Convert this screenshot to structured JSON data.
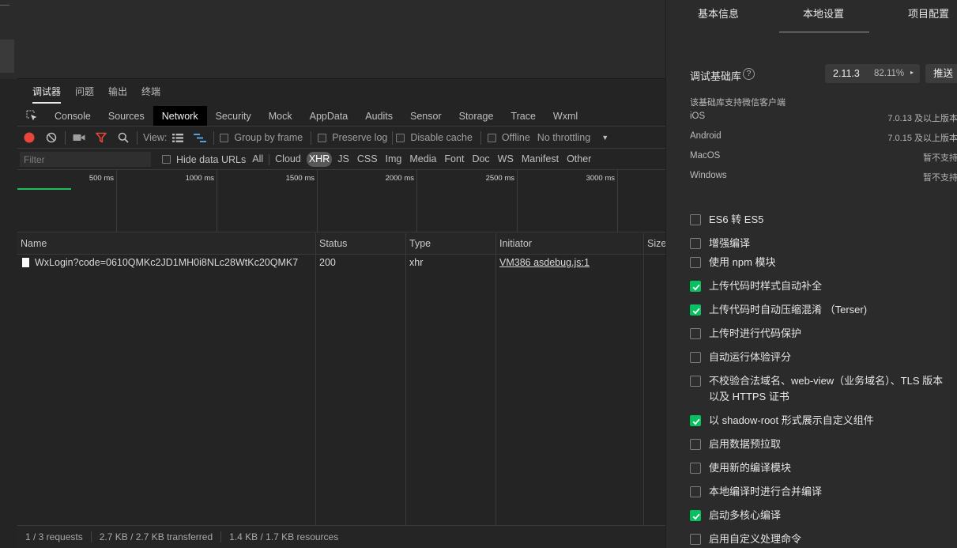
{
  "left_panel": {
    "panel_tabs": [
      "调试器",
      "问题",
      "输出",
      "终端"
    ],
    "tool_tabs": [
      "Console",
      "Sources",
      "Network",
      "Security",
      "Mock",
      "AppData",
      "Audits",
      "Sensor",
      "Storage",
      "Trace",
      "Wxml"
    ],
    "toolbar": {
      "view_label": "View:",
      "group_by_frame": "Group by frame",
      "preserve_log": "Preserve log",
      "disable_cache": "Disable cache",
      "offline": "Offline",
      "throttling": "No throttling"
    },
    "filter": {
      "placeholder": "Filter",
      "hide_data_urls": "Hide data URLs",
      "types": [
        "All",
        "Cloud",
        "XHR",
        "JS",
        "CSS",
        "Img",
        "Media",
        "Font",
        "Doc",
        "WS",
        "Manifest",
        "Other"
      ],
      "active_type": "XHR"
    },
    "overview": {
      "ticks": [
        "500 ms",
        "1000 ms",
        "1500 ms",
        "2000 ms",
        "2500 ms",
        "3000 ms"
      ],
      "bar_color": "#1fbf5a"
    },
    "table": {
      "columns": [
        "Name",
        "Status",
        "Type",
        "Initiator",
        "Size"
      ],
      "rows": [
        {
          "name": "WxLogin?code=0610QMKc2JD1MH0i8NLc28WtKc20QMK7",
          "status": "200",
          "type": "xhr",
          "initiator": "VM386 asdebug.js:1"
        }
      ]
    },
    "status_bar": [
      "1 / 3 requests",
      "2.7 KB / 2.7 KB transferred",
      "1.4 KB / 1.7 KB resources"
    ],
    "colors": {
      "record": "#e8453c",
      "filter_icon": "#e8453c",
      "view_icon": "#5a9fd6"
    }
  },
  "right_panel": {
    "tabs": [
      "基本信息",
      "本地设置",
      "项目配置"
    ],
    "active_tab": "本地设置",
    "debug_lib": {
      "label": "调试基础库",
      "version": "2.11.3",
      "percent": "82.11%",
      "push": "推送"
    },
    "support_note": "该基础库支持微信客户端",
    "os_support": [
      {
        "name": "iOS",
        "value": "7.0.13 及以上版本"
      },
      {
        "name": "Android",
        "value": "7.0.15 及以上版本"
      },
      {
        "name": "MacOS",
        "value": "暂不支持"
      },
      {
        "name": "Windows",
        "value": "暂不支持"
      }
    ],
    "settings": [
      {
        "label": "ES6 转 ES5",
        "checked": false
      },
      {
        "label": "增强编译",
        "checked": false
      },
      {
        "label": "使用 npm 模块",
        "checked": false
      },
      {
        "label": "上传代码时样式自动补全",
        "checked": true
      },
      {
        "label": "上传代码时自动压缩混淆 （Terser)",
        "checked": true
      },
      {
        "label": "上传时进行代码保护",
        "checked": false
      },
      {
        "label": "自动运行体验评分",
        "checked": false
      },
      {
        "label": "不校验合法域名、web-view（业务域名）、TLS 版本以及 HTTPS 证书",
        "checked": false
      },
      {
        "label": "以 shadow-root 形式展示自定义组件",
        "checked": true
      },
      {
        "label": "启用数据预拉取",
        "checked": false
      },
      {
        "label": "使用新的编译模块",
        "checked": false
      },
      {
        "label": "本地编译时进行合并编译",
        "checked": false
      },
      {
        "label": "启动多核心编译",
        "checked": true
      },
      {
        "label": "启用自定义处理命令",
        "checked": false
      }
    ],
    "accent_color": "#07c160"
  }
}
